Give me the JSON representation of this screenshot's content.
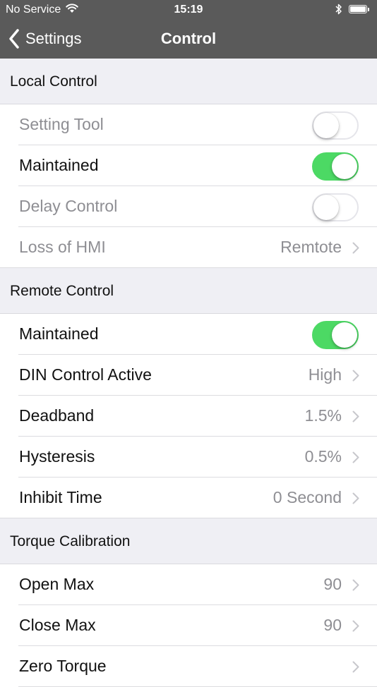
{
  "status_bar": {
    "carrier": "No Service",
    "time": "15:19",
    "icons": [
      "wifi-icon",
      "bluetooth-icon",
      "battery-icon"
    ]
  },
  "nav_bar": {
    "back_label": "Settings",
    "title": "Control"
  },
  "colors": {
    "bar_background": "#5a5a5a",
    "toggle_on": "#4cd964",
    "secondary_text": "#8e8e93",
    "grouped_background": "#efeff4"
  },
  "sections": [
    {
      "title": "Local Control",
      "rows": [
        {
          "label": "Setting Tool",
          "toggle": false,
          "disabled": true
        },
        {
          "label": "Maintained",
          "toggle": true
        },
        {
          "label": "Delay Control",
          "toggle": false,
          "disabled": true
        },
        {
          "label": "Loss of HMI",
          "value": "Remtote",
          "disabled": true
        }
      ]
    },
    {
      "title": "Remote Control",
      "rows": [
        {
          "label": "Maintained",
          "toggle": true
        },
        {
          "label": "DIN Control Active",
          "value": "High"
        },
        {
          "label": "Deadband",
          "value": "1.5%"
        },
        {
          "label": "Hysteresis",
          "value": "0.5%"
        },
        {
          "label": "Inhibit Time",
          "value": "0 Second"
        }
      ]
    },
    {
      "title": "Torque Calibration",
      "rows": [
        {
          "label": "Open Max",
          "value": "90"
        },
        {
          "label": "Close Max",
          "value": "90"
        },
        {
          "label": "Zero Torque",
          "value": ""
        }
      ]
    }
  ]
}
